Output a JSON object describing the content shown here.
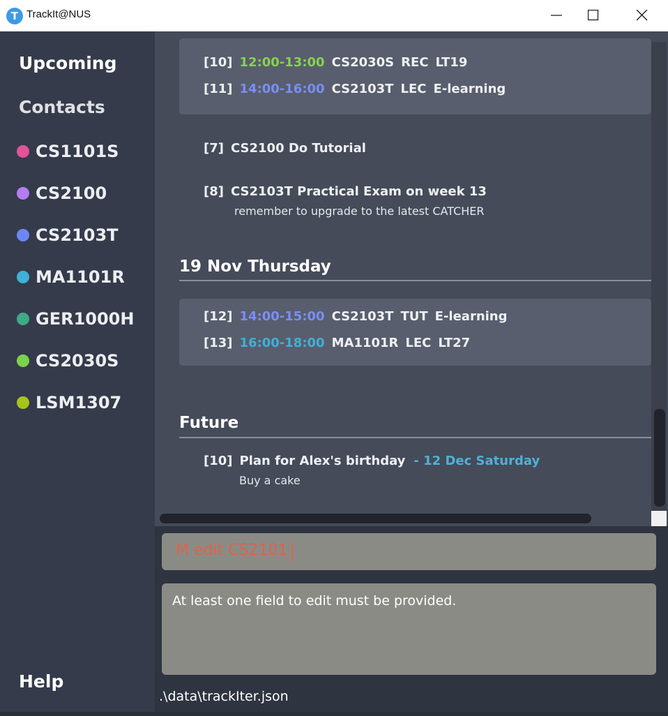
{
  "window": {
    "title": "TrackIt@NUS",
    "icon_letter": "T",
    "controls": [
      "minimize-icon",
      "maximize-icon",
      "close-icon"
    ]
  },
  "sidebar": {
    "links": [
      "Upcoming",
      "Contacts"
    ],
    "modules": [
      {
        "code": "CS1101S",
        "color": "#e2539a"
      },
      {
        "code": "CS2100",
        "color": "#b47cf0"
      },
      {
        "code": "CS2103T",
        "color": "#6c87f5"
      },
      {
        "code": "MA1101R",
        "color": "#3fb1d7"
      },
      {
        "code": "GER1000H",
        "color": "#3eaa87"
      },
      {
        "code": "CS2030S",
        "color": "#7dd34a"
      },
      {
        "code": "LSM1307",
        "color": "#a8c31b"
      }
    ],
    "help": "Help"
  },
  "upcoming": {
    "card1": [
      {
        "index": "[10]",
        "time": "12:00-13:00",
        "time_color": "#8ad24d",
        "module": "CS2030S",
        "type": "REC",
        "venue": "LT19"
      },
      {
        "index": "[11]",
        "time": "14:00-16:00",
        "time_color": "#7a8ef5",
        "module": "CS2103T",
        "type": "LEC",
        "venue": "E-learning"
      }
    ],
    "tasks": [
      {
        "index": "[7]",
        "title": "CS2100 Do Tutorial",
        "note": ""
      },
      {
        "index": "[8]",
        "title": "CS2103T Practical Exam on week 13",
        "note": "remember to upgrade to the latest CATCHER"
      }
    ],
    "day_heading": "19 Nov Thursday",
    "card2": [
      {
        "index": "[12]",
        "time": "14:00-15:00",
        "time_color": "#7a8ef5",
        "module": "CS2103T",
        "type": "TUT",
        "venue": "E-learning"
      },
      {
        "index": "[13]",
        "time": "16:00-18:00",
        "time_color": "#3fb1d7",
        "module": "MA1101R",
        "type": "LEC",
        "venue": "LT27"
      }
    ],
    "future_heading": "Future",
    "future": [
      {
        "index": "[10]",
        "title": "Plan for Alex's birthday",
        "date": "- 12 Dec Saturday",
        "date_color": "#4fb1d8",
        "note": "Buy a cake"
      }
    ]
  },
  "command": {
    "value": "M edit CS2101"
  },
  "result": {
    "text": "At least one field to edit must be provided."
  },
  "status": {
    "path": ".\\data\\trackIter.json"
  }
}
